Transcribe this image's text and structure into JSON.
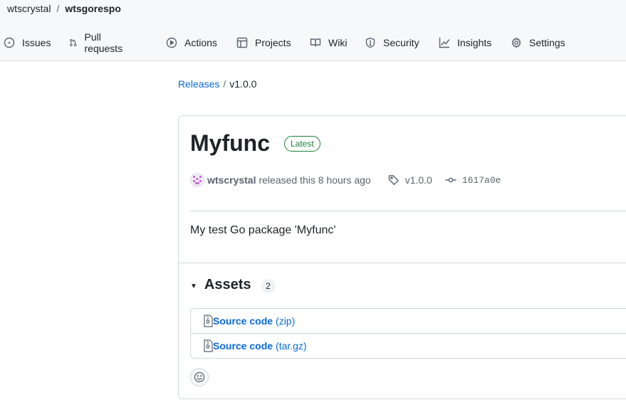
{
  "repo": {
    "owner": "wtscrystal",
    "separator": "/",
    "name": "wtsgorespo"
  },
  "nav": [
    {
      "label": "Issues",
      "icon": "issue-opened-icon"
    },
    {
      "label": "Pull requests",
      "icon": "git-pull-request-icon"
    },
    {
      "label": "Actions",
      "icon": "play-icon"
    },
    {
      "label": "Projects",
      "icon": "table-icon"
    },
    {
      "label": "Wiki",
      "icon": "book-icon"
    },
    {
      "label": "Security",
      "icon": "shield-icon"
    },
    {
      "label": "Insights",
      "icon": "graph-icon"
    },
    {
      "label": "Settings",
      "icon": "gear-icon"
    }
  ],
  "breadcrumb": {
    "releases": "Releases",
    "separator": "/",
    "current": "v1.0.0"
  },
  "release": {
    "title": "Myfunc",
    "badge": "Latest",
    "author": "wtscrystal",
    "released_text": "released this 8 hours ago",
    "tag": "v1.0.0",
    "commit": "1617a0e",
    "body": "My test Go package 'Myfunc'"
  },
  "assets": {
    "title": "Assets",
    "count": "2",
    "items": [
      {
        "name": "Source code",
        "ext": "(zip)"
      },
      {
        "name": "Source code",
        "ext": "(tar.gz)"
      }
    ]
  },
  "colors": {
    "link": "#0969da",
    "latest": "#1a7f37",
    "border": "#d0d7de",
    "muted": "#59636e"
  }
}
